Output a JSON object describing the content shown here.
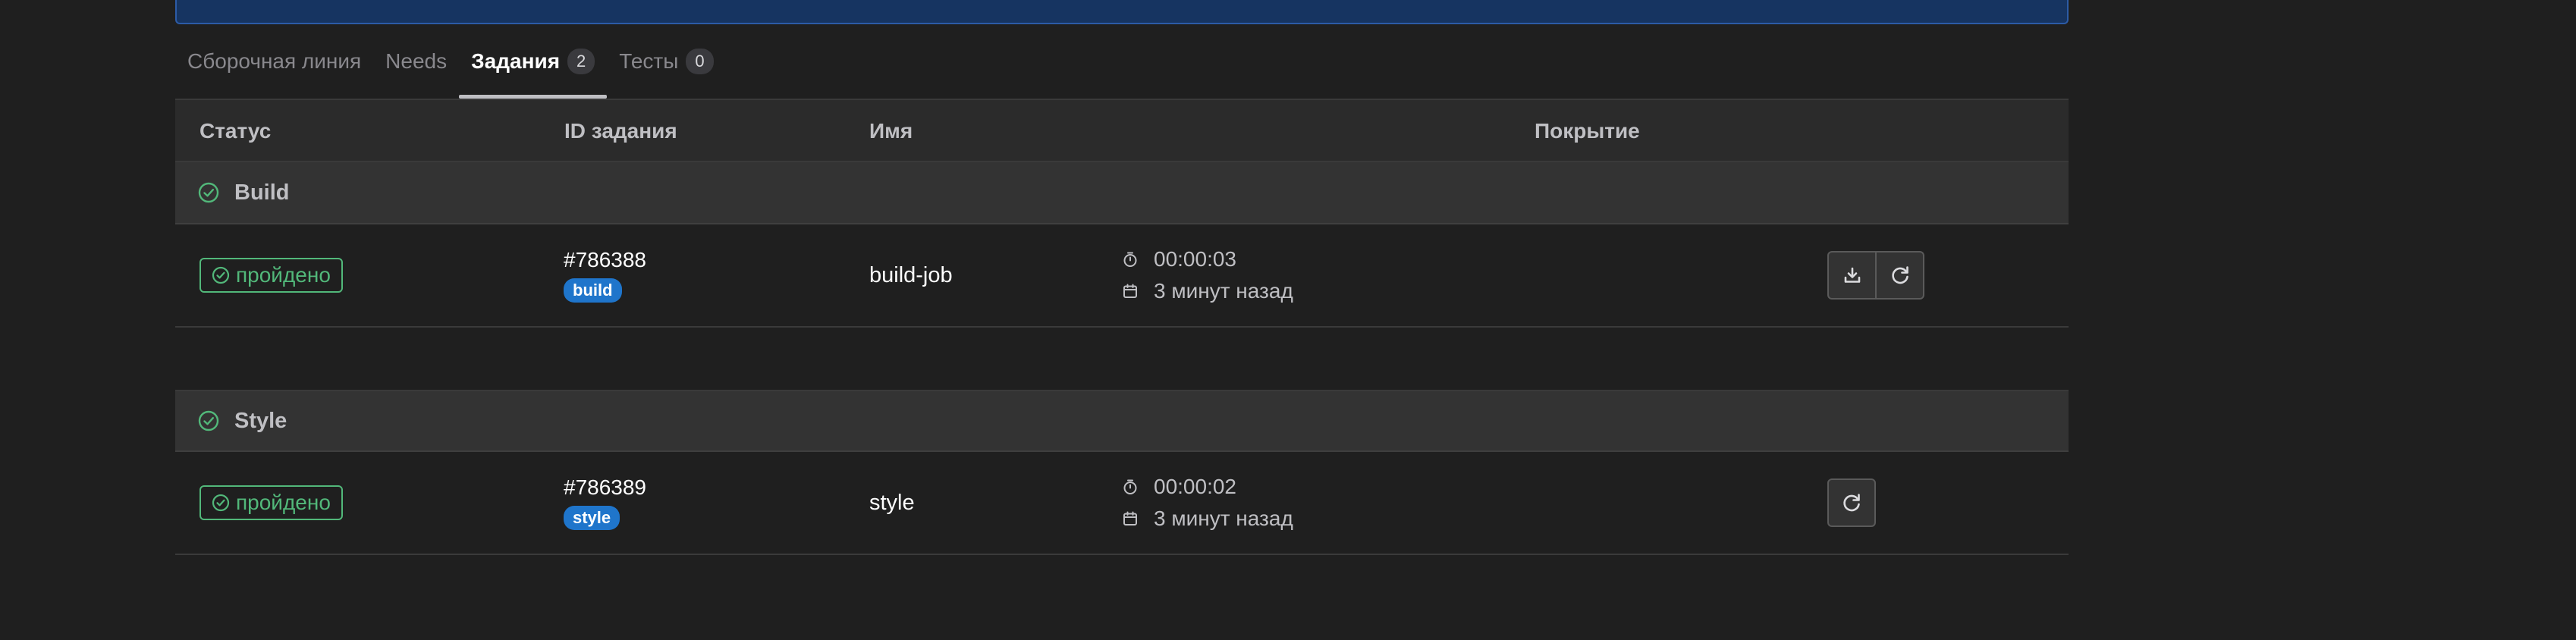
{
  "tabs": [
    {
      "label": "Сборочная линия",
      "count": null
    },
    {
      "label": "Needs",
      "count": null
    },
    {
      "label": "Задания",
      "count": "2",
      "active": true
    },
    {
      "label": "Тесты",
      "count": "0"
    }
  ],
  "table": {
    "headers": {
      "status": "Статус",
      "job_id": "ID задания",
      "name": "Имя",
      "coverage": "Покрытие"
    }
  },
  "groups": [
    {
      "name": "Build",
      "jobs": [
        {
          "status": "пройдено",
          "id": "#786388",
          "stage": "build",
          "name": "build-job",
          "duration": "00:00:03",
          "finished": "3 минут назад",
          "actions": [
            "download-artifacts",
            "retry"
          ]
        }
      ]
    },
    {
      "name": "Style",
      "jobs": [
        {
          "status": "пройдено",
          "id": "#786389",
          "stage": "style",
          "name": "style",
          "duration": "00:00:02",
          "finished": "3 минут назад",
          "actions": [
            "retry"
          ]
        }
      ]
    }
  ],
  "icons": {
    "status": "check-circle-icon",
    "duration": "timer-icon",
    "finished": "calendar-icon",
    "download": "download-icon",
    "retry": "retry-icon"
  },
  "colors": {
    "background": "#1f1f1f",
    "banner": "#163461",
    "success": "#52b87a",
    "stage_pill": "#1f75cb"
  }
}
